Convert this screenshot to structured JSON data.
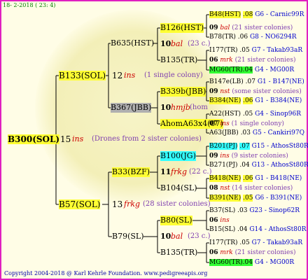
{
  "header": "18-  2-2018 ( 23:  4)",
  "root": {
    "id": "B300(SOL)",
    "num": "15",
    "mark": "ins",
    "note": "(Drones from 2 sister colonies)"
  },
  "p1": {
    "id": "B133(SOL)",
    "num": "12",
    "mark": "ins",
    "note": "(1 single colony)"
  },
  "p2": {
    "id": "B57(SOL)",
    "num": "13",
    "mark": "frkg",
    "note": "(28 sister colonies)"
  },
  "g1": {
    "id": "B635(HST)"
  },
  "g2": {
    "id": "B367(JBB)"
  },
  "g3": {
    "id": "B33(BZF)",
    "num": "11",
    "mark": "frkg",
    "note": "(22 c.)"
  },
  "g4": {
    "id": "B79(SL)"
  },
  "n1": {
    "id": "B126(HST)",
    "num": "10",
    "mark": "bal",
    "note": "(23 c.)"
  },
  "n2": {
    "id": "B135(TR)"
  },
  "n3": {
    "id": "B339b(JBB)",
    "num": "10",
    "mark": "hmjb",
    "note": "(hom"
  },
  "n4": {
    "id": "AhomA63x4(07)"
  },
  "n5": {
    "id": "B100(JG)",
    "num": "11",
    "mark": "frkg",
    "note": "(22 c.)"
  },
  "n6": {
    "id": "B104(SL)"
  },
  "n7": {
    "id": "B80(SL)",
    "num": "10",
    "mark": "bal",
    "note": "(23 c.)"
  },
  "n8": {
    "id": "B135(TR)"
  },
  "leaves": [
    {
      "l1": "B48(HST)",
      "l2": ".08",
      "l3": "G6 - Carnic99R"
    },
    {
      "l1": "09",
      "l2": "bal",
      "l3": "(21 sister colonies)"
    },
    {
      "l1": "B78(TR)",
      "l2": ".06",
      "l3": "G8 - NO6294R"
    },
    {
      "l1": "I177(TR)",
      "l2": ".05",
      "l3": "G7 - Takab93aR"
    },
    {
      "l1": "06",
      "l2": "mrk",
      "l3": "(21 sister colonies)"
    },
    {
      "l1": "MG60(TR)",
      "l2": ".04",
      "l3": "G4 - MG00R"
    },
    {
      "l1": "B147e(LB)",
      "l2": ".07",
      "l3": "G1 - B147(NE)"
    },
    {
      "l1": "09",
      "l2": "nst",
      "l3": "(some sister colonies)"
    },
    {
      "l1": "B384(NE)",
      "l2": ".06",
      "l3": "G1 - B384(NE)"
    },
    {
      "l1": "A22(HST)",
      "l2": ".05",
      "l3": "G4 - Sinop96R"
    },
    {
      "l1": "07",
      "l2": "ins",
      "l3": "(1 single colony)"
    },
    {
      "l1": "A63(JBB)",
      "l2": ".03",
      "l3": "G5 - Cankiri97Q"
    },
    {
      "l1": "B201(PJ)",
      "l2": ".07",
      "l3": "G15 - AthosSt80R"
    },
    {
      "l1": "09",
      "l2": "ins",
      "l3": "(9 sister colonies)"
    },
    {
      "l1": "B271(PJ)",
      "l2": ".04",
      "l3": "G13 - AthosSt80R"
    },
    {
      "l1": "B418(NE)",
      "l2": ".06",
      "l3": "G1 - B418(NE)"
    },
    {
      "l1": "08",
      "l2": "nst",
      "l3": "(14 sister colonies)"
    },
    {
      "l1": "B391(NE)",
      "l2": ".05",
      "l3": "G6 - B391(NE)"
    },
    {
      "l1": "B37(SL)",
      "l2": ".03",
      "l3": "G23 - Sinop62R"
    },
    {
      "l1": "06",
      "l2": "ins",
      "l3": ""
    },
    {
      "l1": "B15(SL)",
      "l2": ".04",
      "l3": "G14 - AthosSt80R"
    },
    {
      "l1": "I177(TR)",
      "l2": ".05",
      "l3": "G7 - Takab93aR"
    },
    {
      "l1": "06",
      "l2": "mrk",
      "l3": "(21 sister colonies)"
    },
    {
      "l1": "MG60(TR)",
      "l2": ".04",
      "l3": "G4 - MG00R"
    }
  ],
  "footer": "Copyright 2004-2018 @ Karl Kehrle Foundation.   www.pedigreeapis.org"
}
